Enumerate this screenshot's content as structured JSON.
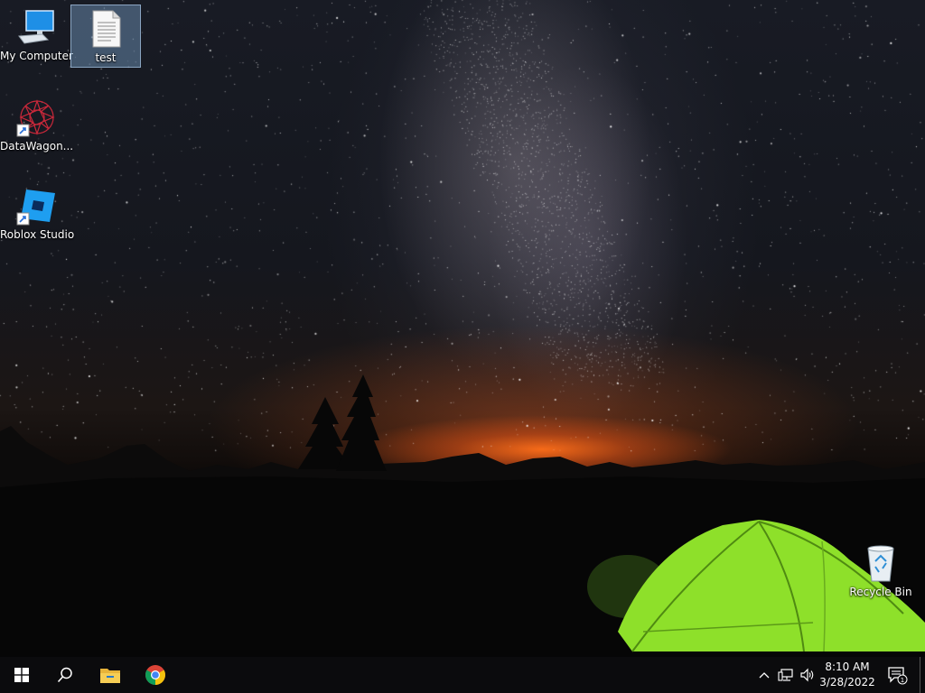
{
  "desktop": {
    "icons": [
      {
        "label": "My Computer"
      },
      {
        "label": "test"
      },
      {
        "label": "DataWagon..."
      },
      {
        "label": "Roblox Studio"
      },
      {
        "label": "Recycle Bin"
      }
    ]
  },
  "taskbar": {
    "time": "8:10 AM",
    "date": "3/28/2022",
    "notification_count": "1"
  },
  "colors": {
    "taskbar": "#0b0b0d",
    "selection": "#7fa0c8",
    "tent": "#8ee02a"
  }
}
